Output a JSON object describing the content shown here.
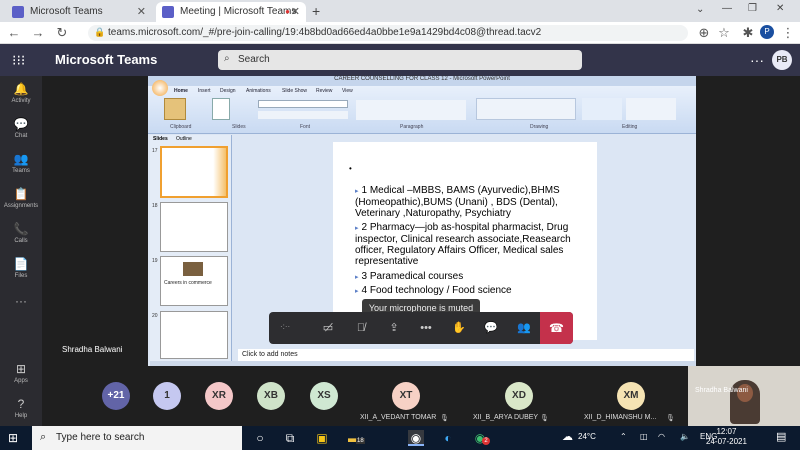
{
  "browser": {
    "tabs": [
      {
        "title": "Microsoft Teams"
      },
      {
        "title": "Meeting | Microsoft Teams"
      }
    ],
    "new_tab": "+",
    "url": "teams.microsoft.com/_#/pre-join-calling/19:4b8bd0ad66ed4a0bbe1e9a1429bd4c08@thread.tacv2",
    "profile_initial": "P"
  },
  "teams": {
    "app_name": "Microsoft Teams",
    "search_placeholder": "Search",
    "more": "···",
    "user_initials": "PB"
  },
  "rail": [
    {
      "label": "Activity",
      "icon": "bell-icon",
      "glyph": "🔔"
    },
    {
      "label": "Chat",
      "icon": "chat-icon",
      "glyph": "💬"
    },
    {
      "label": "Teams",
      "icon": "teams-icon",
      "glyph": "👥"
    },
    {
      "label": "Assignments",
      "icon": "assignments-icon",
      "glyph": "📋"
    },
    {
      "label": "Calls",
      "icon": "phone-icon",
      "glyph": "📞"
    },
    {
      "label": "Files",
      "icon": "files-icon",
      "glyph": "📄"
    },
    {
      "label": "···",
      "icon": "more-icon",
      "glyph": ""
    },
    {
      "label": "Apps",
      "icon": "apps-icon",
      "glyph": "⊞"
    },
    {
      "label": "Help",
      "icon": "help-icon",
      "glyph": "?"
    }
  ],
  "powerpoint": {
    "window_title": "CAREER COUNSELLING FOR CLASS 12 - Microsoft PowerPoint",
    "ribbon_tabs": [
      "Home",
      "Insert",
      "Design",
      "Animations",
      "Slide Show",
      "Review",
      "View"
    ],
    "ribbon_groups": [
      "Clipboard",
      "Slides",
      "Font",
      "Paragraph",
      "Drawing",
      "Editing"
    ],
    "panel_tabs": [
      "Slides",
      "Outline"
    ],
    "thumb_numbers": [
      "17",
      "18",
      "19",
      "20"
    ],
    "thumb_caption": "Careers in commerce",
    "notes_placeholder": "Click to add notes",
    "slide_bullets": [
      "1  Medical –MBBS, BAMS (Ayurvedic),BHMS (Homeopathic),BUMS (Unani) , BDS (Dental), Veterinary ,Naturopathy, Psychiatry",
      "2  Pharmacy—job as-hospital pharmacist, Drug inspector, Clinical research associate,Reasearch officer, Regulatory Affairs Officer, Medical sales representative",
      "3 Paramedical courses",
      "4 Food technology / Food science"
    ]
  },
  "presenter_name": "Shradha Balwani",
  "toast": "Your microphone is muted",
  "call_timer": "·:··",
  "participants": [
    {
      "initials": "+21",
      "color": "#6264a7",
      "label": ""
    },
    {
      "initials": "1",
      "color": "#c5c8f0",
      "label": ""
    },
    {
      "initials": "XR",
      "color": "#f4c7c8",
      "label": ""
    },
    {
      "initials": "XB",
      "color": "#cfe3c9",
      "label": ""
    },
    {
      "initials": "XS",
      "color": "#cfe8d2",
      "label": ""
    },
    {
      "initials": "XT",
      "color": "#f6d1c5",
      "label": "XII_A_VEDANT TOMAR"
    },
    {
      "initials": "XD",
      "color": "#d9e7c8",
      "label": "XII_B_ARYA DUBEY"
    },
    {
      "initials": "XM",
      "color": "#f5e3b3",
      "label": "XII_D_HIMANSHU M..."
    }
  ],
  "self_name": "Shradha Balwani",
  "taskbar": {
    "search_placeholder": "Type here to search",
    "weather": "24°C",
    "lang": "ENG",
    "time": "12:07",
    "date": "24-07-2021",
    "notify_badge": "18",
    "chrome_badge": "2"
  }
}
